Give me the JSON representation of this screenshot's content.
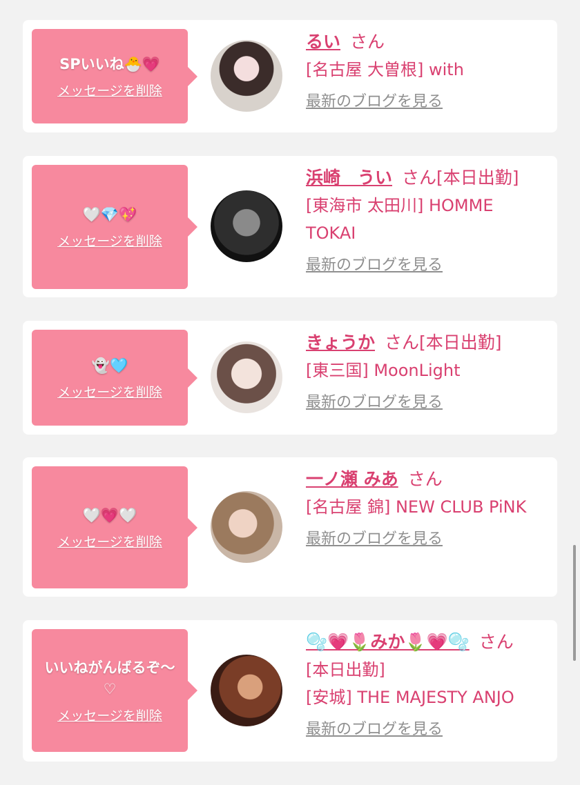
{
  "cards": [
    {
      "message": "SPいいね🐣💗",
      "delete_label": "メッセージを削除",
      "name": "るい",
      "san": "さん",
      "tag": "",
      "shop": "[名古屋 大曽根] with",
      "blog_label": "最新のブログを見る"
    },
    {
      "message": "🤍💎💖",
      "delete_label": "メッセージを削除",
      "name": "浜崎　うい",
      "san": "さん",
      "tag": "[本日出勤]",
      "shop": "[東海市 太田川] HOMME TOKAI",
      "blog_label": "最新のブログを見る"
    },
    {
      "message": "👻🩵",
      "delete_label": "メッセージを削除",
      "name": "きょうか",
      "san": "さん",
      "tag": "[本日出勤]",
      "shop": "[東三国] MoonLight",
      "blog_label": "最新のブログを見る"
    },
    {
      "message": "🤍💗🤍",
      "delete_label": "メッセージを削除",
      "name": "一ノ瀬 みあ",
      "san": "さん",
      "tag": "",
      "shop": "[名古屋 錦] NEW CLUB PiNK",
      "blog_label": "最新のブログを見る"
    },
    {
      "message": "いいねがんばるぞ〜♡",
      "delete_label": "メッセージを削除",
      "name": "🫧💗🌷みか🌷💗🫧",
      "san": "さん",
      "tag": "[本日出勤]",
      "shop": "[安城] THE MAJESTY ANJO",
      "blog_label": "最新のブログを見る"
    }
  ],
  "colors": {
    "bubble": "#f7899e",
    "name": "#d94070",
    "blog_link": "#8f8f8f",
    "background": "#f2f2f2"
  }
}
